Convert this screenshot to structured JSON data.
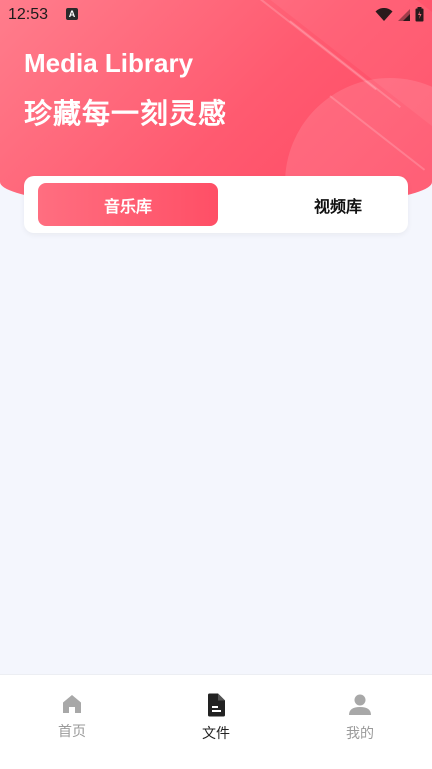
{
  "status": {
    "time": "12:53",
    "app_glyph": "A"
  },
  "header": {
    "title": "Media Library",
    "subtitle": "珍藏每一刻灵感"
  },
  "tabs": [
    {
      "label": "音乐库",
      "active": true
    },
    {
      "label": "视频库",
      "active": false
    }
  ],
  "bottom_nav": [
    {
      "label": "首页",
      "icon": "home-icon",
      "active": false
    },
    {
      "label": "文件",
      "icon": "file-icon",
      "active": true
    },
    {
      "label": "我的",
      "icon": "user-icon",
      "active": false
    }
  ],
  "colors": {
    "accent": "#ff5a70",
    "background": "#f4f6fd"
  }
}
